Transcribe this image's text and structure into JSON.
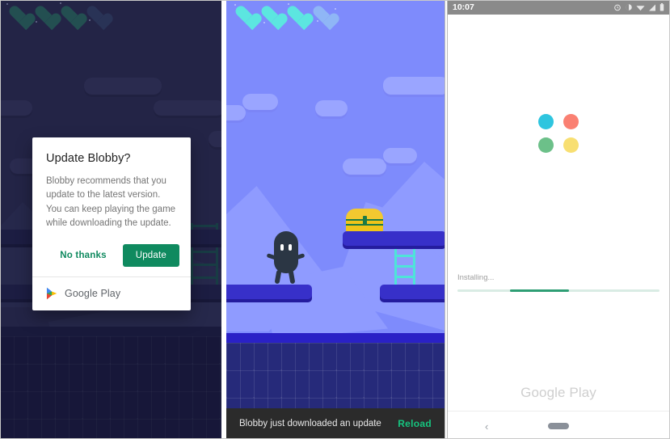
{
  "panel1": {
    "name": "in-game update dialog",
    "hud": {
      "hearts_total": 4,
      "hearts_filled": 3,
      "icon": "heart-icon"
    },
    "dialog": {
      "title": "Update Blobby?",
      "body": "Blobby recommends that you update to the latest version. You can keep playing the game while downloading the update.",
      "dismiss_label": "No thanks",
      "confirm_label": "Update",
      "footer_brand": "Google Play",
      "footer_icon": "google-play-logo-icon",
      "confirm_color": "#0f8a5f",
      "dismiss_color": "#0f8a5f"
    }
  },
  "panel2": {
    "name": "game running with update snackbar",
    "hud": {
      "hearts_total": 4,
      "hearts_filled": 3,
      "icon": "heart-icon"
    },
    "scene": {
      "sky_color": "#7e8bfc",
      "platform_color": "#3730c9",
      "ladder_color": "#4ee4d8",
      "chest_icon": "treasure-chest-icon",
      "character_icon": "blob-character-icon"
    },
    "snackbar": {
      "message": "Blobby just downloaded an update",
      "action_label": "Reload",
      "action_color": "#16c47f",
      "background": "#2b2b2b"
    }
  },
  "panel3": {
    "name": "google play installing screen",
    "statusbar": {
      "clock": "10:07",
      "icons": [
        "alarm-icon",
        "do-not-disturb-icon",
        "wifi-icon",
        "signal-icon",
        "battery-icon"
      ],
      "background": "#8a8a8a"
    },
    "play_logo": {
      "icon": "google-play-four-dots-icon",
      "dots": [
        {
          "name": "dot-cyan",
          "color": "#2ec5df"
        },
        {
          "name": "dot-red",
          "color": "#fa8072"
        },
        {
          "name": "dot-green",
          "color": "#6cc089"
        },
        {
          "name": "dot-yellow",
          "color": "#f8df72"
        }
      ]
    },
    "progress": {
      "label": "Installing...",
      "percent": 55,
      "start_percent": 26,
      "track_color": "#d9ece4",
      "bar_color": "#2e9e74"
    },
    "footer_brand": "Google Play",
    "navbar": {
      "back_icon": "chevron-left-icon",
      "home_pill_icon": "home-pill-icon"
    }
  }
}
